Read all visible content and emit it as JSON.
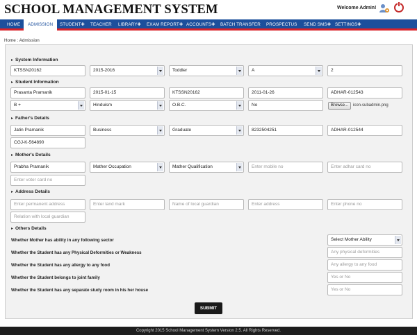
{
  "header": {
    "title": "SCHOOL MANAGEMENT SYSTEM",
    "welcome": "Welcome Admin!",
    "icons": [
      "user-settings-icon",
      "power-icon"
    ]
  },
  "nav": {
    "items": [
      "HOME",
      "ADMISSION",
      "STUDENT✚",
      "TEACHER",
      "LIBRARY✚",
      "EXAM REPORT✚",
      "ACCOUNTS✚",
      "BATCH TRANSFER",
      "PROSPECTUS",
      "SEND SMS✚",
      "SETTINGS✚"
    ],
    "active": "ADMISSION"
  },
  "breadcrumb": "Home : Admission",
  "sections": {
    "system": "System Information",
    "student": "Student Information",
    "father": "Father's Details",
    "mother": "Mother's Details",
    "address": "Address Details",
    "others": "Others Details"
  },
  "system": {
    "code": "KTSSN20162",
    "session": "2015-2016",
    "class": "Toddler",
    "section": "A",
    "roll": "2"
  },
  "student": {
    "name": "Prasanta Pramanik",
    "dob": "2015-01-15",
    "code": "KTSSN20162",
    "admission_date": "2011-01-26",
    "adhar": "ADHAR-012543",
    "blood_group": "B +",
    "religion": "Hinduism",
    "caste": "O.B.C.",
    "field_no": "No",
    "browse": "Browse...",
    "file": "icon-subadmin.png"
  },
  "father": {
    "name": "Jatin Pramanik",
    "occupation": "Business",
    "qualification": "Graduate",
    "mobile": "8232504251",
    "adhar": "ADHAR-012544",
    "voter": "CGJ-K-564890"
  },
  "mother": {
    "name": "Prabha Pramanik",
    "occupation": "Mather Occupation",
    "qualification": "Mather Qualification",
    "mobile_ph": "Enter mobile no",
    "adhar_ph": "Enter adhar card no",
    "voter_ph": "Enter voter card no"
  },
  "address": {
    "permanent_ph": "Enter permanent address",
    "landmark_ph": "Enter land mark",
    "guardian_ph": "Name of local guardian",
    "address_ph": "Enter address",
    "phone_ph": "Enter phone no",
    "relation_ph": "Relation with local guardian"
  },
  "others": {
    "q1": "Whether Mother has ability in any following sector",
    "q1_value": "Select Mother Ability",
    "q2": "Whether the Student has any Physical Deformities or Weakness",
    "q2_ph": "Any physical deformities",
    "q3": "Whether the Student has any allergy to any food",
    "q3_ph": "Any allergy to any food",
    "q4": "Whether the Student belongs to joint family",
    "q4_ph": "Yes or No",
    "q5": "Whether the Student has any separate study room in his her house",
    "q5_ph": "Yes or No"
  },
  "submit": "SUBMIT",
  "footer": "Copyright 2015 School Management System Version 2.5. All Rights Reserved.",
  "colors": {
    "nav": "#1c4f9c",
    "accent": "#d8232a",
    "button": "#1a1a1a"
  }
}
